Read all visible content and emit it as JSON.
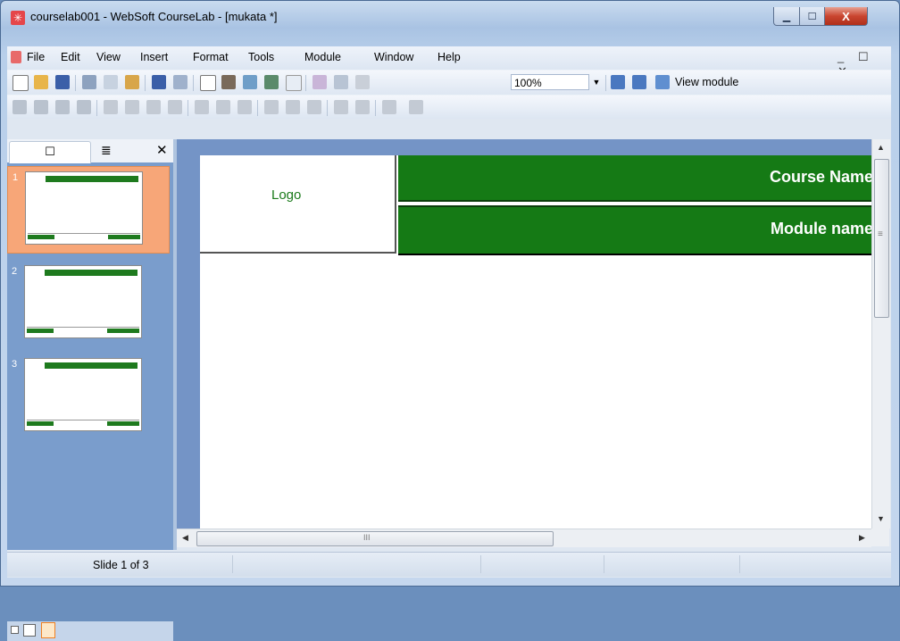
{
  "window": {
    "title": "courselab001 - WebSoft CourseLab - [mukata *]",
    "app_icon_glyph": "✳",
    "min_glyph": "▁",
    "max_glyph": "☐",
    "close_glyph": "X"
  },
  "menu": {
    "items": [
      "File",
      "Edit",
      "View",
      "Insert",
      "Format",
      "Tools",
      "Module",
      "Window",
      "Help"
    ],
    "mdi_controls": "_ ☐ ✕"
  },
  "toolbar": {
    "zoom": "100%",
    "zoom_arrow": "▼",
    "view_module_label": "View module",
    "icon_names": [
      "new-icon",
      "open-icon",
      "save-icon",
      "cut-icon",
      "copy-icon",
      "paste-icon",
      "undo-icon",
      "redo-icon",
      "text-icon",
      "image-icon",
      "picture-icon",
      "object-icon",
      "pointer-icon",
      "eraser-icon",
      "properties-icon",
      "format-painter-icon",
      "import-icon",
      "export-icon"
    ]
  },
  "panel": {
    "tab_slides_glyph": "☐",
    "tab_outline_glyph": "≣",
    "close_glyph": "✕",
    "slides": [
      {
        "number": "1",
        "selected": true
      },
      {
        "number": "2",
        "selected": false
      },
      {
        "number": "3",
        "selected": false
      }
    ]
  },
  "slide": {
    "logo": "Logo",
    "course_name": "Course Name",
    "module_name": "Module name"
  },
  "scroll": {
    "up": "▲",
    "down": "▼",
    "left": "◀",
    "right": "▶",
    "grip": "≡",
    "hgrip": "III"
  },
  "status": {
    "slide_info": "Slide 1 of 3"
  },
  "colors": {
    "header_green": "#157a15",
    "selected_thumb": "#f7a678",
    "canvas_bg": "#7494c6"
  }
}
